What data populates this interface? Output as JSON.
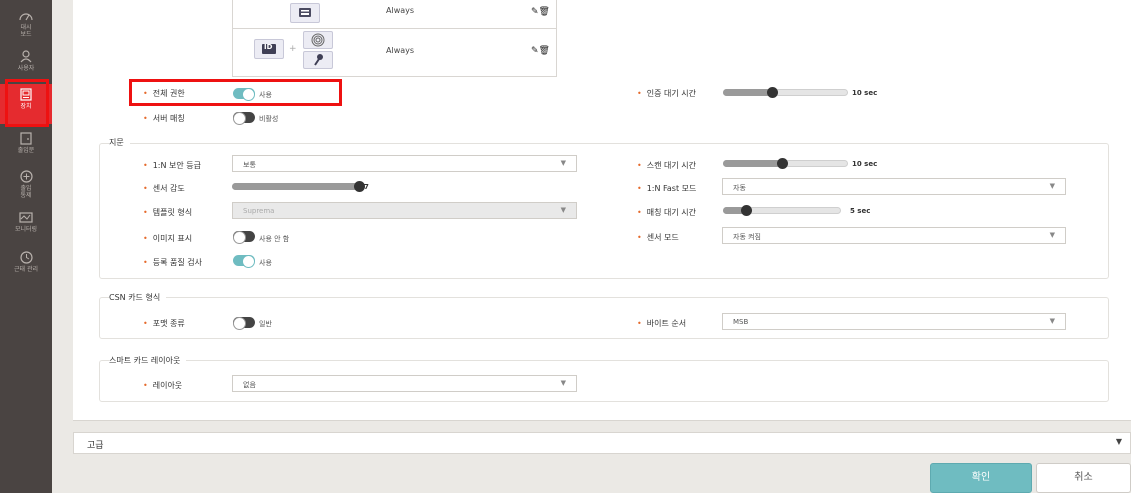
{
  "sidebar": {
    "items": [
      {
        "label": "대시\n보드",
        "icon": "dashboard-gauge-icon"
      },
      {
        "label": "사용자",
        "icon": "user-icon"
      },
      {
        "label": "장치",
        "icon": "device-icon"
      },
      {
        "label": "출입문",
        "icon": "door-icon"
      },
      {
        "label": "출입\n통제",
        "icon": "access-control-icon"
      },
      {
        "label": "모니터링",
        "icon": "monitoring-icon"
      },
      {
        "label": "근태 관리",
        "icon": "time-attendance-icon"
      }
    ]
  },
  "auth_table": {
    "rows": [
      {
        "mode": "card",
        "schedule": "Always"
      },
      {
        "mode": "id-fingerprint-pin",
        "id_text": "ID",
        "schedule": "Always"
      }
    ]
  },
  "general": {
    "full_access_label": "전체 권한",
    "full_access_state": "사용",
    "server_matching_label": "서버 매칭",
    "server_matching_state": "비활성",
    "auth_timeout_label": "인증 대기 시간",
    "auth_timeout_value": "10 sec",
    "auth_timeout_level": 0.4
  },
  "fingerprint": {
    "section_title": "지문",
    "security_level_label": "1:N 보안 등급",
    "security_level_value": "보통",
    "sensitivity_label": "센서 감도",
    "sensitivity_value": "7",
    "sensitivity_level": 1.0,
    "template_label": "템플릿 형식",
    "template_value": "Suprema",
    "show_image_label": "이미지 표시",
    "show_image_state": "사용 안 함",
    "quality_check_label": "등록 품질 검사",
    "quality_check_state": "사용",
    "scan_timeout_label": "스캔 대기 시간",
    "scan_timeout_value": "10 sec",
    "scan_timeout_level": 0.48,
    "fast_mode_label": "1:N Fast 모드",
    "fast_mode_value": "자동",
    "matching_timeout_label": "매칭 대기 시간",
    "matching_timeout_value": "5 sec",
    "matching_timeout_level": 0.2,
    "sensor_mode_label": "센서 모드",
    "sensor_mode_value": "자동 켜짐"
  },
  "csn": {
    "section_title": "CSN 카드 형식",
    "format_type_label": "포맷 종류",
    "format_type_state": "일반",
    "byte_order_label": "바이트 순서",
    "byte_order_value": "MSB"
  },
  "smartcard": {
    "section_title": "스마트 카드 레이아웃",
    "layout_label": "레이아웃",
    "layout_value": "없음"
  },
  "advanced": {
    "title": "고급"
  },
  "buttons": {
    "ok": "확인",
    "cancel": "취소"
  },
  "colors": {
    "accent": "#6fbcc1",
    "highlight": "#ee1111",
    "sidebar": "#4a4442",
    "active_nav": "#e52b2f"
  }
}
